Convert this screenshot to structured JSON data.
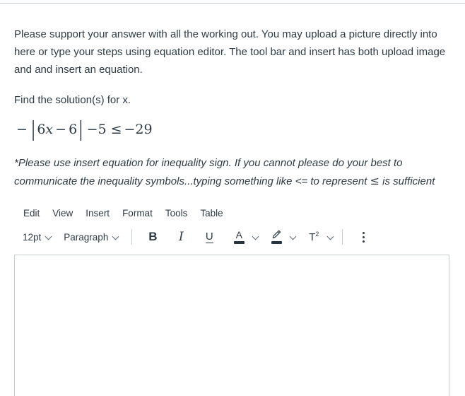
{
  "assignment": {
    "intro": "Please support your answer with all the working out. You may upload a picture directly into here or type your steps using equation editor. The tool bar and insert has both upload image and and insert an equation.",
    "instruction": "Find the solution(s) for x.",
    "equation": {
      "neg": "−",
      "bar_open": "|",
      "coefficient": "6",
      "variable": "x",
      "minus": "−",
      "constant": "6",
      "bar_close": "|",
      "offset": "−5",
      "relation": "≤",
      "right_side": "−29",
      "plain_text": "− | 6x − 6 | −5 ≤ −29"
    },
    "note_part1": "*Please use insert equation for inequality sign. If you cannot please do your best to communicate the inequality symbols...typing something like <= to represent ",
    "note_symbol": "≤",
    "note_part2": " is sufficient"
  },
  "editor": {
    "menu": [
      {
        "label": "Edit",
        "name": "edit"
      },
      {
        "label": "View",
        "name": "view"
      },
      {
        "label": "Insert",
        "name": "insert"
      },
      {
        "label": "Format",
        "name": "format"
      },
      {
        "label": "Tools",
        "name": "tools"
      },
      {
        "label": "Table",
        "name": "table"
      }
    ],
    "toolbar": {
      "font_size": "12pt",
      "block_format": "Paragraph",
      "bold_label": "B",
      "italic_label": "I",
      "underline_label": "U",
      "text_color_label": "A",
      "superscript_label": "T",
      "superscript_exponent": "2",
      "icons": {
        "chevron": "chevron-down-icon",
        "text_color": "text-color-icon",
        "highlight": "highlight-color-icon",
        "superscript": "superscript-icon",
        "more": "more-options-kebab-icon"
      },
      "swatch_text_color": "#273540",
      "swatch_highlight_color": "#273540"
    },
    "content": ""
  },
  "colors": {
    "text": "#2d3b45",
    "border": "#c7cdd1",
    "icon": "#2d3b45"
  }
}
